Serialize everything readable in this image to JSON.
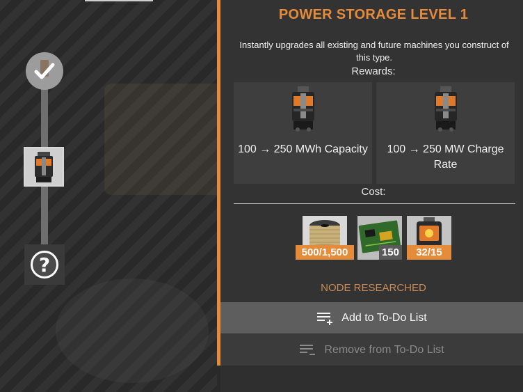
{
  "panel": {
    "title": "POWER STORAGE LEVEL 1",
    "description": "Instantly upgrades all existing and future machines you construct of this type.",
    "rewards_label": "Rewards:",
    "rewards": [
      {
        "text": "100 → 250 MWh Capacity",
        "icon": "power-storage-icon"
      },
      {
        "text": "100 → 250 MW Charge Rate",
        "icon": "power-storage-icon"
      }
    ],
    "cost_label": "Cost:",
    "costs": [
      {
        "icon": "wire-spool-icon",
        "amount": "500/1,500",
        "insufficient": true
      },
      {
        "icon": "circuit-board-icon",
        "amount": "150",
        "insufficient": false
      },
      {
        "icon": "battery-icon",
        "amount": "32/15",
        "insufficient": true
      }
    ],
    "status": "NODE RESEARCHED",
    "add_todo_label": "Add to To-Do List",
    "remove_todo_label": "Remove from To-Do List"
  },
  "tree": {
    "nodes": [
      {
        "state": "researched",
        "icon": "checkmark-icon"
      },
      {
        "state": "selected",
        "icon": "power-storage-icon"
      },
      {
        "state": "locked",
        "icon": "question-mark-icon",
        "glyph": "?"
      }
    ]
  },
  "colors": {
    "accent": "#e58b39",
    "panel_bg": "#333333",
    "button_active": "#5e5e5e",
    "button_disabled": "#3b3b3b",
    "status_text": "#c98a55"
  }
}
